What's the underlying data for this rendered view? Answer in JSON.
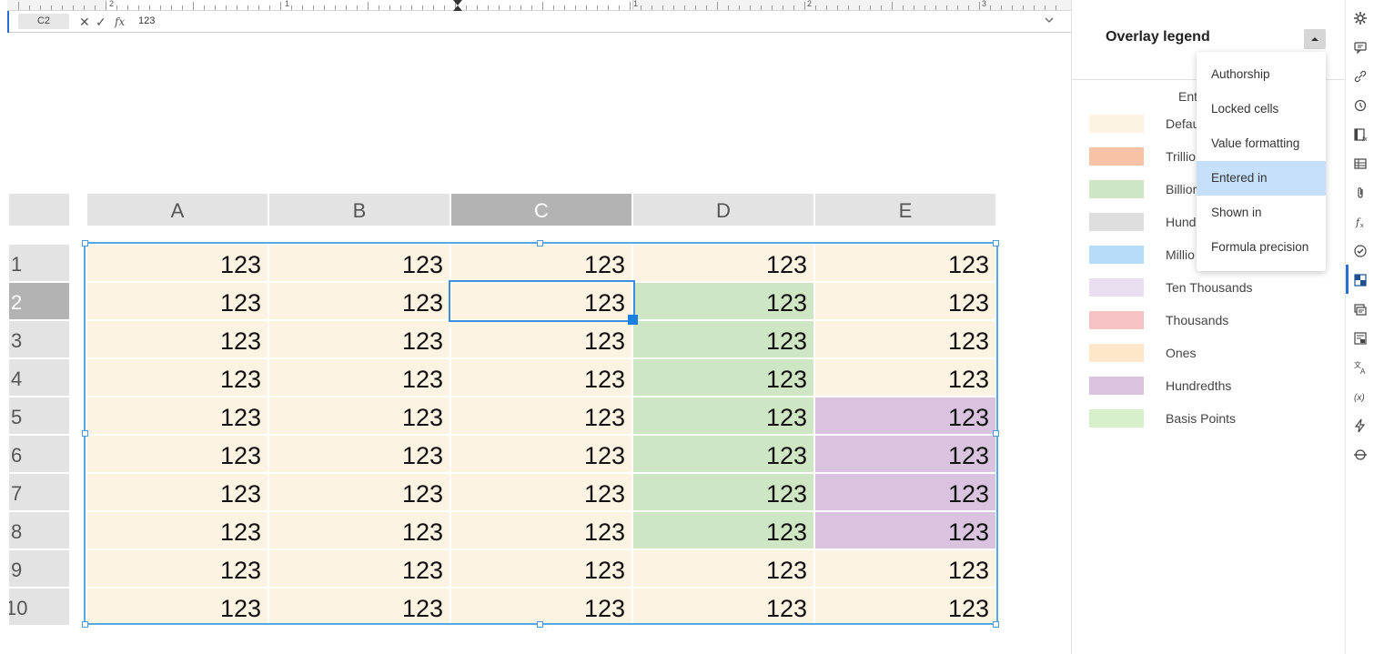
{
  "ruler": {
    "numbers": [
      "2",
      "1",
      "1",
      "2",
      "3"
    ]
  },
  "formula_bar": {
    "cell_ref": "C2",
    "value": "123",
    "cancel_icon": "✕",
    "accept_icon": "✓",
    "fx_icon": "fx",
    "expand_icon": "chevron-down-icon"
  },
  "sheet": {
    "columns": [
      "A",
      "B",
      "C",
      "D",
      "E"
    ],
    "rows": [
      "1",
      "2",
      "3",
      "4",
      "5",
      "6",
      "7",
      "8",
      "9",
      "10"
    ],
    "selected_column": "C",
    "selected_row": "2",
    "cells": [
      [
        "123",
        "123",
        "123",
        "123",
        "123"
      ],
      [
        "123",
        "123",
        "123",
        "123",
        "123"
      ],
      [
        "123",
        "123",
        "123",
        "123",
        "123"
      ],
      [
        "123",
        "123",
        "123",
        "123",
        "123"
      ],
      [
        "123",
        "123",
        "123",
        "123",
        "123"
      ],
      [
        "123",
        "123",
        "123",
        "123",
        "123"
      ],
      [
        "123",
        "123",
        "123",
        "123",
        "123"
      ],
      [
        "123",
        "123",
        "123",
        "123",
        "123"
      ],
      [
        "123",
        "123",
        "123",
        "123",
        "123"
      ],
      [
        "123",
        "123",
        "123",
        "123",
        "123"
      ]
    ],
    "cell_overlay": [
      [
        "default",
        "default",
        "default",
        "default",
        "default"
      ],
      [
        "default",
        "default",
        "default",
        "billions",
        "default"
      ],
      [
        "default",
        "default",
        "default",
        "billions",
        "default"
      ],
      [
        "default",
        "default",
        "default",
        "billions",
        "default"
      ],
      [
        "default",
        "default",
        "default",
        "billions",
        "hundredths"
      ],
      [
        "default",
        "default",
        "default",
        "billions",
        "hundredths"
      ],
      [
        "default",
        "default",
        "default",
        "billions",
        "hundredths"
      ],
      [
        "default",
        "default",
        "default",
        "billions",
        "hundredths"
      ],
      [
        "default",
        "default",
        "default",
        "default",
        "default"
      ],
      [
        "default",
        "default",
        "default",
        "default",
        "default"
      ]
    ]
  },
  "panel": {
    "title": "Overlay legend",
    "legend_heading": "Ent",
    "legend": [
      {
        "label": "Defau",
        "color": "#fdf3e2"
      },
      {
        "label": "Trillio",
        "color": "#f8c3a5"
      },
      {
        "label": "Billior",
        "color": "#cfe6c4"
      },
      {
        "label": "Hund",
        "color": "#dedede"
      },
      {
        "label": "Millio",
        "color": "#b7dcf8"
      },
      {
        "label": "Ten Thousands",
        "color": "#eadff0"
      },
      {
        "label": "Thousands",
        "color": "#f7c2c4"
      },
      {
        "label": "Ones",
        "color": "#fde7c8"
      },
      {
        "label": "Hundredths",
        "color": "#d9c3df"
      },
      {
        "label": "Basis Points",
        "color": "#d7f0cb"
      }
    ],
    "dropdown": {
      "options": [
        "Authorship",
        "Locked cells",
        "Value formatting",
        "Entered in",
        "Shown in",
        "Formula precision"
      ],
      "selected": "Entered in"
    }
  },
  "toolbar": {
    "icons": [
      "gear-icon",
      "comment-icon",
      "link-icon",
      "history-icon",
      "formula-table-icon",
      "table-icon",
      "attachment-icon",
      "function-icon",
      "check-circle-icon",
      "overlay-icon",
      "notes-icon",
      "form-icon",
      "translate-icon",
      "variable-icon",
      "lightning-icon",
      "strikethrough-icon"
    ],
    "active": "overlay-icon"
  }
}
